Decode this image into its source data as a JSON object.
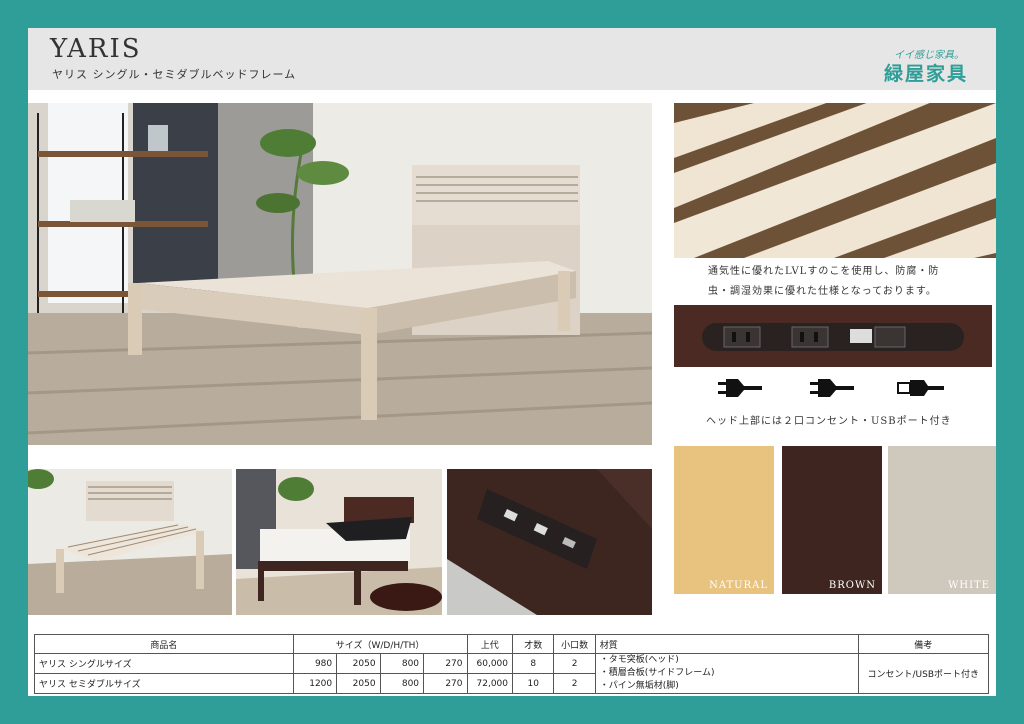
{
  "header": {
    "title": "YARIS",
    "subtitle": "ヤリス シングル・セミダブルベッドフレーム",
    "brand_tagline": "イイ感じ家具。",
    "brand_name": "緑屋家具"
  },
  "captions": {
    "slats": [
      "通気性に優れたLVLすのこを使用し、防腐・防",
      "虫・調湿効果に優れた仕様となっております。"
    ],
    "outlet": "ヘッド上部には２口コンセント・USBポート付き"
  },
  "swatches": [
    {
      "label": "NATURAL",
      "color": "#e8c27f"
    },
    {
      "label": "BROWN",
      "color": "#3f2520"
    },
    {
      "label": "WHITE",
      "color": "#cfc8bd"
    }
  ],
  "icons": [
    "plug-icon",
    "plug-icon",
    "usb-icon"
  ],
  "table": {
    "headers": {
      "name": "商品名",
      "size": "サイズ（W/D/H/TH）",
      "price": "上代",
      "volume": "才数",
      "pieces": "小口数",
      "material": "材質",
      "note": "備考"
    },
    "rows": [
      {
        "name": "ヤリス シングルサイズ",
        "w": "980",
        "d": "2050",
        "h": "800",
        "th": "270",
        "price": "60,000",
        "volume": "8",
        "pieces": "2"
      },
      {
        "name": "ヤリス セミダブルサイズ",
        "w": "1200",
        "d": "2050",
        "h": "800",
        "th": "270",
        "price": "72,000",
        "volume": "10",
        "pieces": "2"
      }
    ],
    "materials": [
      "・タモ突板(ヘッド)",
      "・積層合板(サイドフレーム)",
      "・パイン無垢材(脚)"
    ],
    "note": "コンセント/USBポート付き"
  }
}
